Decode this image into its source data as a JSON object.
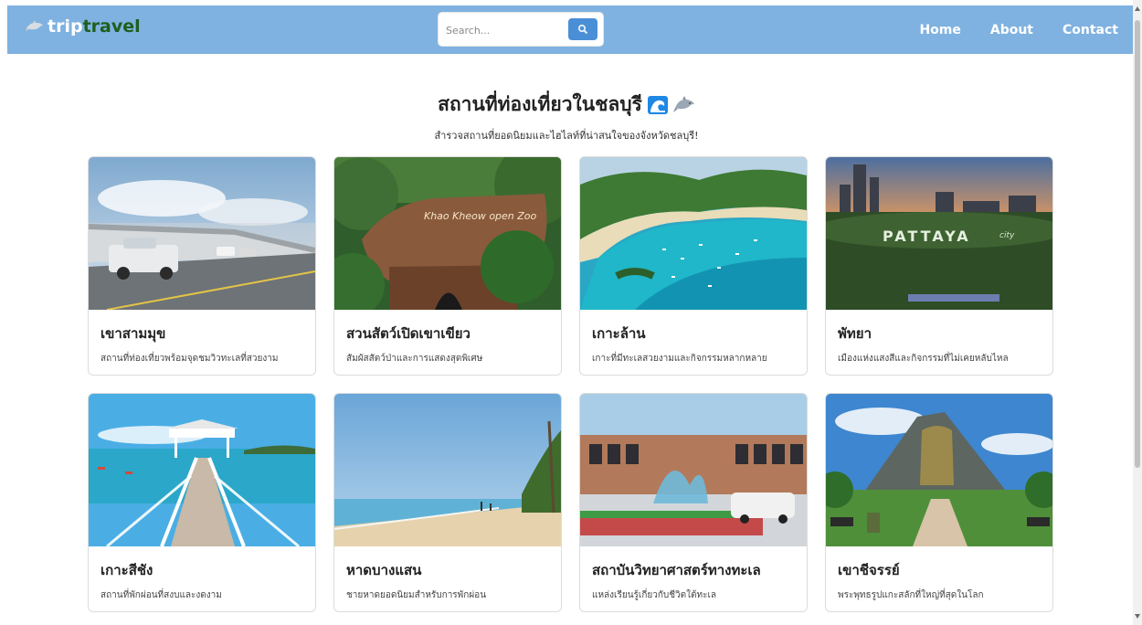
{
  "navbar": {
    "brand_part1": "trip",
    "brand_part2": "travel",
    "search_placeholder": "Search...",
    "links": [
      "Home",
      "About",
      "Contact"
    ],
    "bg_color": "#7fb2e0",
    "search_icon": "magnifier-icon"
  },
  "header": {
    "title": "สถานที่ท่องเที่ยวในชลบุรี",
    "title_icons": [
      "wave-icon",
      "dolphin-icon"
    ],
    "subtitle": "สำรวจสถานที่ยอดนิยมและไฮไลท์ที่น่าสนใจของจังหวัดชลบุรี!"
  },
  "cards": [
    {
      "title": "เขาสามมุข",
      "desc": "สถานที่ท่องเที่ยวพร้อมจุดชมวิวทะเลที่สวยงาม"
    },
    {
      "title": "สวนสัตว์เปิดเขาเขียว",
      "desc": "สัมผัสสัตว์ป่าและการแสดงสุดพิเศษ"
    },
    {
      "title": "เกาะล้าน",
      "desc": "เกาะที่มีทะเลสวยงามและกิจกรรมหลากหลาย"
    },
    {
      "title": "พัทยา",
      "desc": "เมืองแห่งแสงสีและกิจกรรมที่ไม่เคยหลับไหล"
    },
    {
      "title": "เกาะสีชัง",
      "desc": "สถานที่พักผ่อนที่สงบและงดงาม"
    },
    {
      "title": "หาดบางแสน",
      "desc": "ชายหาดยอดนิยมสำหรับการพักผ่อน"
    },
    {
      "title": "สถาบันวิทยาศาสตร์ทางทะเล",
      "desc": "แหล่งเรียนรู้เกี่ยวกับชีวิตใต้ทะเล"
    },
    {
      "title": "เขาชีจรรย์",
      "desc": "พระพุทธรูปแกะสลักที่ใหญ่ที่สุดในโลก"
    }
  ],
  "card_image_signs": {
    "khao_kheow": "Khao Kheow open Zoo",
    "pattaya": "PATTAYA",
    "pattaya_city": "city"
  }
}
